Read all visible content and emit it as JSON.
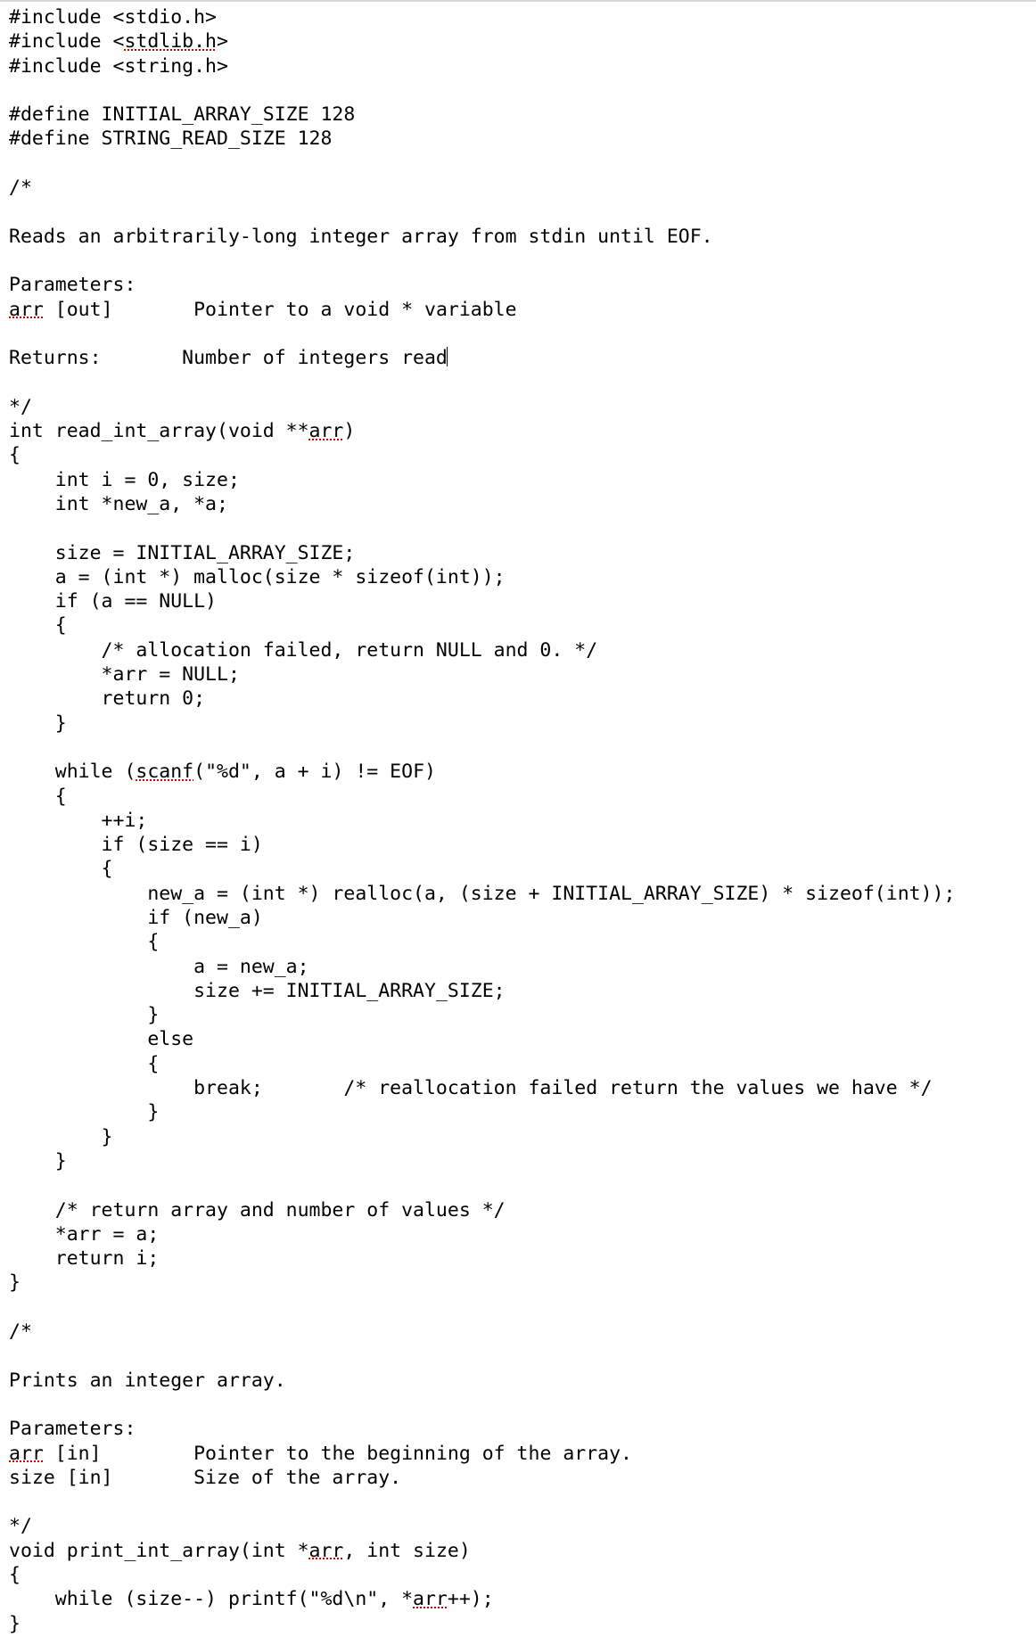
{
  "c": {
    "l01a": "#include <stdio.h>",
    "l02a": "#include <",
    "l02b": "stdlib.h",
    "l02c": ">",
    "l03a": "#include <string.h>",
    "l05a": "#define INITIAL_ARRAY_SIZE 128",
    "l06a": "#define STRING_READ_SIZE 128",
    "l08a": "/*",
    "l10a": "Reads an arbitrarily-long integer array from stdin until EOF.",
    "l12a": "Parameters:",
    "l13a": "arr",
    "l13b": " [out]       Pointer to a void * variable",
    "l15a": "Returns:       Number of integers read",
    "l17a": "*/",
    "l18a": "int read_int_array(void **",
    "l18b": "arr",
    "l18c": ")",
    "l19a": "{",
    "l20a": "    int i = 0, size;",
    "l21a": "    int *new_a, *a;",
    "l23a": "    size = INITIAL_ARRAY_SIZE;",
    "l24a": "    a = (int *) malloc(size * sizeof(int));",
    "l25a": "    if (a == NULL)",
    "l26a": "    {",
    "l27a": "        /* allocation failed, return NULL and 0. */",
    "l28a": "        *arr = NULL;",
    "l29a": "        return 0;",
    "l30a": "    }",
    "l32a": "    while (",
    "l32b": "scanf",
    "l32c": "(\"%d\", a + i) != EOF)",
    "l33a": "    {",
    "l34a": "        ++i;",
    "l35a": "        if (size == i)",
    "l36a": "        {",
    "l37a": "            new_a = (int *) realloc(a, (size + INITIAL_ARRAY_SIZE) * sizeof(int));",
    "l38a": "            if (new_a)",
    "l39a": "            {",
    "l40a": "                a = new_a;",
    "l41a": "                size += INITIAL_ARRAY_SIZE;",
    "l42a": "            }",
    "l43a": "            else",
    "l44a": "            {",
    "l45a": "                break;       /* reallocation failed return the values we have */",
    "l46a": "            }",
    "l47a": "        }",
    "l48a": "    }",
    "l50a": "    /* return array and number of values */",
    "l51a": "    *arr = a;",
    "l52a": "    return i;",
    "l53a": "}",
    "l55a": "/*",
    "l57a": "Prints an integer array.",
    "l59a": "Parameters:",
    "l60a": "arr",
    "l60b": " [in]        Pointer to the beginning of the array.",
    "l61a": "size [in]       Size of the array.",
    "l63a": "*/",
    "l64a": "void print_int_array(int *",
    "l64b": "arr",
    "l64c": ", int size)",
    "l65a": "{",
    "l66a": "    while (size--) printf(\"%d\\n\", *",
    "l66b": "arr",
    "l66c": "++);",
    "l67a": "}"
  }
}
